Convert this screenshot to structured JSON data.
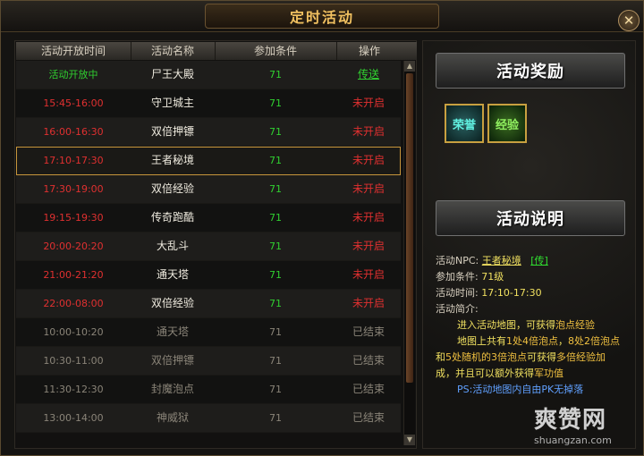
{
  "window": {
    "title": "定时活动",
    "close_label": "✕"
  },
  "table": {
    "headers": [
      "活动开放时间",
      "活动名称",
      "参加条件",
      "操作"
    ],
    "rows": [
      {
        "time": "活动开放中",
        "name": "尸王大殿",
        "cond": "71",
        "op": "传送",
        "time_color": "#30d030",
        "name_color": "#f0ece0",
        "cond_color": "#30d030",
        "op_color": "#30d030",
        "op_link": true
      },
      {
        "time": "15:45-16:00",
        "name": "守卫城主",
        "cond": "71",
        "op": "未开启",
        "time_color": "#e03030",
        "name_color": "#f0ece0",
        "cond_color": "#30d030",
        "op_color": "#e03030"
      },
      {
        "time": "16:00-16:30",
        "name": "双倍押镖",
        "cond": "71",
        "op": "未开启",
        "time_color": "#e03030",
        "name_color": "#f0ece0",
        "cond_color": "#30d030",
        "op_color": "#e03030"
      },
      {
        "time": "17:10-17:30",
        "name": "王者秘境",
        "cond": "71",
        "op": "未开启",
        "time_color": "#e03030",
        "name_color": "#f0ece0",
        "cond_color": "#30d030",
        "op_color": "#e03030",
        "selected": true
      },
      {
        "time": "17:30-19:00",
        "name": "双倍经验",
        "cond": "71",
        "op": "未开启",
        "time_color": "#e03030",
        "name_color": "#f0ece0",
        "cond_color": "#30d030",
        "op_color": "#e03030"
      },
      {
        "time": "19:15-19:30",
        "name": "传奇跑酷",
        "cond": "71",
        "op": "未开启",
        "time_color": "#e03030",
        "name_color": "#f0ece0",
        "cond_color": "#30d030",
        "op_color": "#e03030"
      },
      {
        "time": "20:00-20:20",
        "name": "大乱斗",
        "cond": "71",
        "op": "未开启",
        "time_color": "#e03030",
        "name_color": "#f0ece0",
        "cond_color": "#30d030",
        "op_color": "#e03030"
      },
      {
        "time": "21:00-21:20",
        "name": "通天塔",
        "cond": "71",
        "op": "未开启",
        "time_color": "#e03030",
        "name_color": "#f0ece0",
        "cond_color": "#30d030",
        "op_color": "#e03030"
      },
      {
        "time": "22:00-08:00",
        "name": "双倍经验",
        "cond": "71",
        "op": "未开启",
        "time_color": "#e03030",
        "name_color": "#f0ece0",
        "cond_color": "#30d030",
        "op_color": "#e03030"
      },
      {
        "time": "10:00-10:20",
        "name": "通天塔",
        "cond": "71",
        "op": "已结束",
        "time_color": "#8a8478",
        "name_color": "#8a8478",
        "cond_color": "#8a8478",
        "op_color": "#8a8478"
      },
      {
        "time": "10:30-11:00",
        "name": "双倍押镖",
        "cond": "71",
        "op": "已结束",
        "time_color": "#8a8478",
        "name_color": "#8a8478",
        "cond_color": "#8a8478",
        "op_color": "#8a8478"
      },
      {
        "time": "11:30-12:30",
        "name": "封魔泡点",
        "cond": "71",
        "op": "已结束",
        "time_color": "#8a8478",
        "name_color": "#8a8478",
        "cond_color": "#8a8478",
        "op_color": "#8a8478"
      },
      {
        "time": "13:00-14:00",
        "name": "神威狱",
        "cond": "71",
        "op": "已结束",
        "time_color": "#8a8478",
        "name_color": "#8a8478",
        "cond_color": "#8a8478",
        "op_color": "#8a8478"
      }
    ]
  },
  "reward": {
    "banner": "活动奖励",
    "icons": [
      {
        "label": "荣誉",
        "icon": "honor-icon"
      },
      {
        "label": "经验",
        "icon": "experience-icon"
      }
    ]
  },
  "description": {
    "banner": "活动说明",
    "npc_label": "活动NPC:",
    "npc_value": "王者秘境",
    "npc_link": "[传]",
    "cond_label": "参加条件:",
    "cond_value": "71级",
    "time_label": "活动时间:",
    "time_value": "17:10-17:30",
    "intro_label": "活动简介:",
    "line1_a": "进入活动地图，可获得",
    "line1_b": "泡点经验",
    "line2_a": "地图上共有",
    "line2_b": "1处4倍泡点",
    "line2_c": "，",
    "line2_d": "8处2倍泡点",
    "line3_a": "和",
    "line3_b": "5处随机的3倍泡点",
    "line3_c": "可获得",
    "line3_d": "多倍经验加",
    "line4_a": "成，并且可以额外获得",
    "line4_b": "军功值",
    "ps": "PS:活动地图内自由PK无掉落"
  },
  "watermark": {
    "brand": "爽赞网",
    "url": "shuangzan.com"
  }
}
